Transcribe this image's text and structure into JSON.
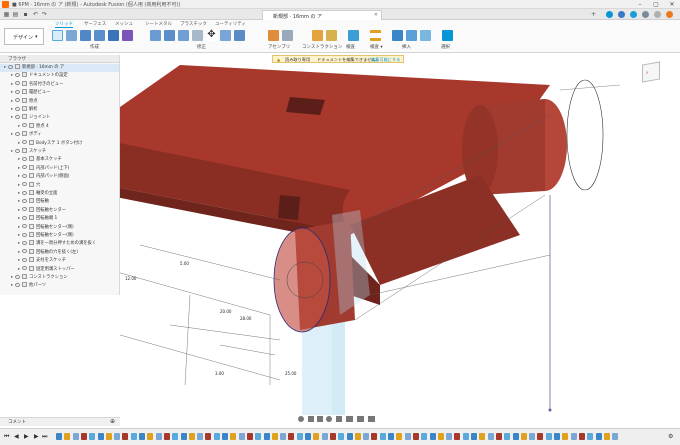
{
  "window": {
    "title": "■ 6PM · 16mm の ア (新規) - Autodesk Fusion (個人用 (商用利用不可))",
    "doc_tab_label": "新規部 · 16mm の ア"
  },
  "ribbon": {
    "workspace": "デザイン",
    "tabs": [
      "ソリッド",
      "サーフェス",
      "メッシュ",
      "シートメタル",
      "プラスチック",
      "ユーティリティ"
    ],
    "active_tab": "ソリッド",
    "groups": [
      "作成",
      "修正",
      "アセンブリ",
      "コンストラクション",
      "検査",
      "挿入",
      "選択"
    ]
  },
  "browser": {
    "header": "ブラウザ",
    "items": [
      {
        "label": "新規部 · 16mm の ア",
        "indent": 0,
        "selected": true
      },
      {
        "label": "ドキュメントの設定",
        "indent": 1
      },
      {
        "label": "名前付きのビュー",
        "indent": 1
      },
      {
        "label": "履歴ビュー",
        "indent": 1
      },
      {
        "label": "原点",
        "indent": 1
      },
      {
        "label": "解析",
        "indent": 1
      },
      {
        "label": "ジョイント",
        "indent": 1
      },
      {
        "label": "原点 4",
        "indent": 2
      },
      {
        "label": "ボディ",
        "indent": 1
      },
      {
        "label": "Bodyステ 1 ボタン付け",
        "indent": 2
      },
      {
        "label": "スケッチ",
        "indent": 1
      },
      {
        "label": "基本スケッチ",
        "indent": 2
      },
      {
        "label": "内部パッド(上下)",
        "indent": 2
      },
      {
        "label": "内部パッド(側面)",
        "indent": 2
      },
      {
        "label": "穴",
        "indent": 2
      },
      {
        "label": "軸受の立面",
        "indent": 2
      },
      {
        "label": "回転軸",
        "indent": 2
      },
      {
        "label": "回転軸センター",
        "indent": 2
      },
      {
        "label": "回転軸端 1",
        "indent": 2
      },
      {
        "label": "回転軸センター(側)",
        "indent": 2
      },
      {
        "label": "回転軸センター(側)",
        "indent": 2
      },
      {
        "label": "溝を一周分押すための溝を抜く",
        "indent": 2
      },
      {
        "label": "回転軸の穴を抜く(左)",
        "indent": 2
      },
      {
        "label": "支柱をスケッチ",
        "indent": 2
      },
      {
        "label": "固定用溝ストッパー",
        "indent": 2
      },
      {
        "label": "コンストラクション",
        "indent": 1
      },
      {
        "label": "他パーツ",
        "indent": 1
      }
    ]
  },
  "banner": {
    "text": "読み取り専用",
    "detail": "ドキュメントを編集できません。",
    "link": "編集可能にする"
  },
  "comments": {
    "label": "コメント"
  },
  "colors": {
    "accent": "#0696d7",
    "body_red": "#a8382c",
    "body_dark": "#7d2a21",
    "highlight_blue": "#9fd6f0"
  }
}
